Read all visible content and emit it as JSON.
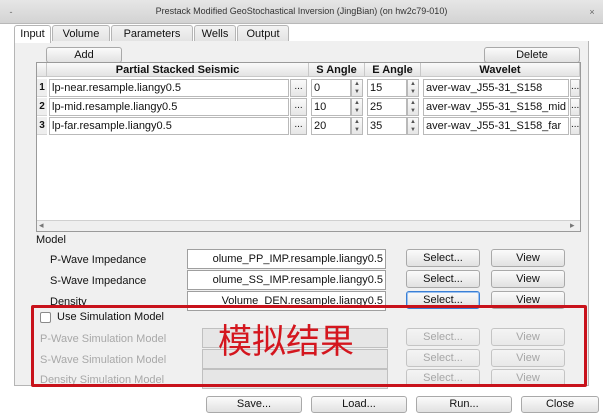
{
  "window": {
    "title": "Prestack Modified GeoStochastical Inversion (JingBian) (on hw2c79-010)",
    "close_glyph": "×",
    "menu_glyph": "-"
  },
  "tabs": [
    "Input",
    "Volume",
    "Parameters",
    "Wells",
    "Output"
  ],
  "active_tab": "Input",
  "table_toolbar": {
    "add_label": "Add",
    "delete_label": "Delete"
  },
  "table": {
    "headers": [
      "Partial Stacked Seismic",
      "S Angle",
      "E Angle",
      "Wavelet"
    ],
    "rows": [
      {
        "num": "1",
        "seismic": "lp-near.resample.liangy0.5",
        "s_angle": "0",
        "e_angle": "15",
        "wavelet": "aver-wav_J55-31_S158"
      },
      {
        "num": "2",
        "seismic": "lp-mid.resample.liangy0.5",
        "s_angle": "10",
        "e_angle": "25",
        "wavelet": "aver-wav_J55-31_S158_mid"
      },
      {
        "num": "3",
        "seismic": "lp-far.resample.liangy0.5",
        "s_angle": "20",
        "e_angle": "35",
        "wavelet": "aver-wav_J55-31_S158_far"
      }
    ],
    "browse_glyph": "...",
    "spin_up": "▲",
    "spin_down": "▼",
    "scroll_left": "◂",
    "scroll_right": "▸"
  },
  "model": {
    "section_label": "Model",
    "rows": [
      {
        "label": "P-Wave Impedance",
        "value": "olume_PP_IMP.resample.liangy0.5",
        "select": "Select...",
        "view": "View"
      },
      {
        "label": "S-Wave Impedance",
        "value": "olume_SS_IMP.resample.liangy0.5",
        "select": "Select...",
        "view": "View"
      },
      {
        "label": "Density",
        "value": "_Volume_DEN.resample.liangy0.5",
        "select": "Select...",
        "view": "View"
      }
    ]
  },
  "simulation": {
    "checkbox_label": "Use Simulation Model",
    "checked": false,
    "rows": [
      {
        "label": "P-Wave Simulation Model",
        "value": "",
        "select": "Select...",
        "view": "View"
      },
      {
        "label": "S-Wave Simulation Model",
        "value": "",
        "select": "Select...",
        "view": "View"
      },
      {
        "label": "Density Simulation Model",
        "value": "",
        "select": "Select...",
        "view": "View"
      }
    ],
    "annotation_text": "模拟结果",
    "annotation_color": "#c8121b"
  },
  "footer": {
    "save": "Save...",
    "load": "Load...",
    "run": "Run...",
    "close": "Close"
  }
}
